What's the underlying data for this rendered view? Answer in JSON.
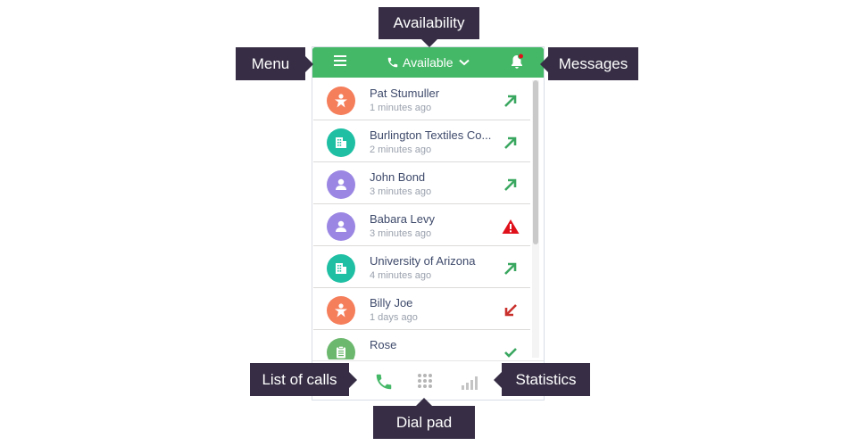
{
  "colors": {
    "header": "#45b867",
    "callout_bg": "#372e45",
    "callout_text": "#ffffff",
    "avatar_orange": "#f57e5b",
    "avatar_teal": "#1fbfa4",
    "avatar_purple": "#9b87e3",
    "avatar_green": "#6db86f",
    "outgoing_arrow": "#3aa760",
    "incoming_arrow": "#c9302c",
    "warning": "#e0101b",
    "notification_dot": "#e0101b"
  },
  "header": {
    "menu_icon": "hamburger-menu-icon",
    "availability_label": "Available",
    "availability_icon": "phone-icon",
    "dropdown_icon": "chevron-down-icon",
    "messages_icon": "bell-icon"
  },
  "calls": [
    {
      "name": "Pat Stumuller",
      "time": "1 minutes ago",
      "avatar_icon": "person-badge-icon",
      "avatar_color": "#f57e5b",
      "status_icon": "outgoing-arrow-icon"
    },
    {
      "name": "Burlington Textiles Co...",
      "time": "2 minutes ago",
      "avatar_icon": "building-icon",
      "avatar_color": "#1fbfa4",
      "status_icon": "outgoing-arrow-icon"
    },
    {
      "name": "John Bond",
      "time": "3 minutes ago",
      "avatar_icon": "user-icon",
      "avatar_color": "#9b87e3",
      "status_icon": "outgoing-arrow-icon"
    },
    {
      "name": "Babara Levy",
      "time": "3 minutes ago",
      "avatar_icon": "user-icon",
      "avatar_color": "#9b87e3",
      "status_icon": "warning-icon"
    },
    {
      "name": "University of Arizona",
      "time": "4 minutes ago",
      "avatar_icon": "building-icon",
      "avatar_color": "#1fbfa4",
      "status_icon": "outgoing-arrow-icon"
    },
    {
      "name": "Billy Joe",
      "time": "1 days ago",
      "avatar_icon": "person-badge-icon",
      "avatar_color": "#f57e5b",
      "status_icon": "incoming-arrow-icon"
    },
    {
      "name": "Rose",
      "time": "",
      "avatar_icon": "clipboard-icon",
      "avatar_color": "#6db86f",
      "status_icon": "check-icon"
    }
  ],
  "footer": {
    "calls_icon": "phone-icon",
    "dialpad_icon": "dialpad-icon",
    "statistics_icon": "bar-chart-icon"
  },
  "callouts": {
    "availability": "Availability",
    "menu": "Menu",
    "messages": "Messages",
    "list_of_calls": "List of calls",
    "statistics": "Statistics",
    "dial_pad": "Dial pad"
  }
}
